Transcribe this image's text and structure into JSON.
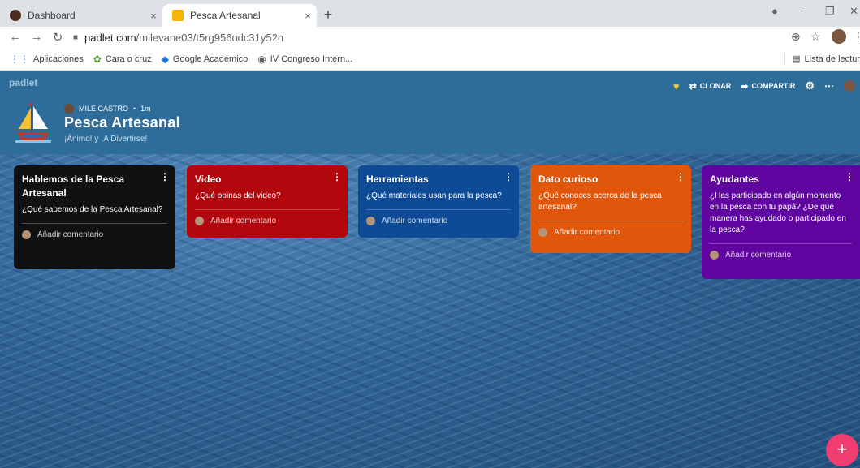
{
  "browser": {
    "tabs": [
      {
        "title": "Dashboard",
        "active": false,
        "favicon_color": "#4a2c1d"
      },
      {
        "title": "Pesca Artesanal",
        "active": true,
        "favicon_color": "#f4b400"
      }
    ],
    "tab_close": "×",
    "new_tab": "+",
    "url_host": "padlet.com",
    "url_path": "/milevane03/t5rg956odc31y52h",
    "bookmarks": [
      {
        "icon": "apps-grid-icon",
        "label": "Aplicaciones"
      },
      {
        "icon": "leaf-icon",
        "label": "Cara o cruz"
      },
      {
        "icon": "graduation-cap-icon",
        "label": "Google Académico"
      },
      {
        "icon": "globe-icon",
        "label": "IV Congreso Intern..."
      }
    ],
    "reading_list": "Lista de lectur"
  },
  "padlet": {
    "logo": "padlet",
    "actions": {
      "clone": "CLONAR",
      "share": "COMPARTIR"
    },
    "author": "MILE CASTRO",
    "time": "1m",
    "board_title": "Pesca Artesanal",
    "board_subtitle": "¡Ánimo! y ¡A Divertirse!",
    "columns": [
      {
        "title": "Hablemos de la Pesca Artesanal",
        "body": "¿Qué sabemos de la Pesca Artesanal?",
        "comment": "Añadir comentario",
        "color": "#111111"
      },
      {
        "title": "Video",
        "body": "¿Qué opinas del video?",
        "comment": "Añadir comentario",
        "color": "#b3070e"
      },
      {
        "title": "Herramientas",
        "body": "¿Qué materiales usan para la pesca?",
        "comment": "Añadir comentario",
        "color": "#0d4b97"
      },
      {
        "title": "Dato curioso",
        "body": "¿Qué conoces acerca de la pesca artesanal?",
        "comment": "Añadir comentario",
        "color": "#e0570b"
      },
      {
        "title": "Ayudantes",
        "body": "¿Has participado en algún momento en la pesca con tu papá? ¿De qué manera has ayudado o participado en la pesca?",
        "comment": "Añadir comentario",
        "color": "#5f049e"
      }
    ],
    "fab": "+"
  }
}
